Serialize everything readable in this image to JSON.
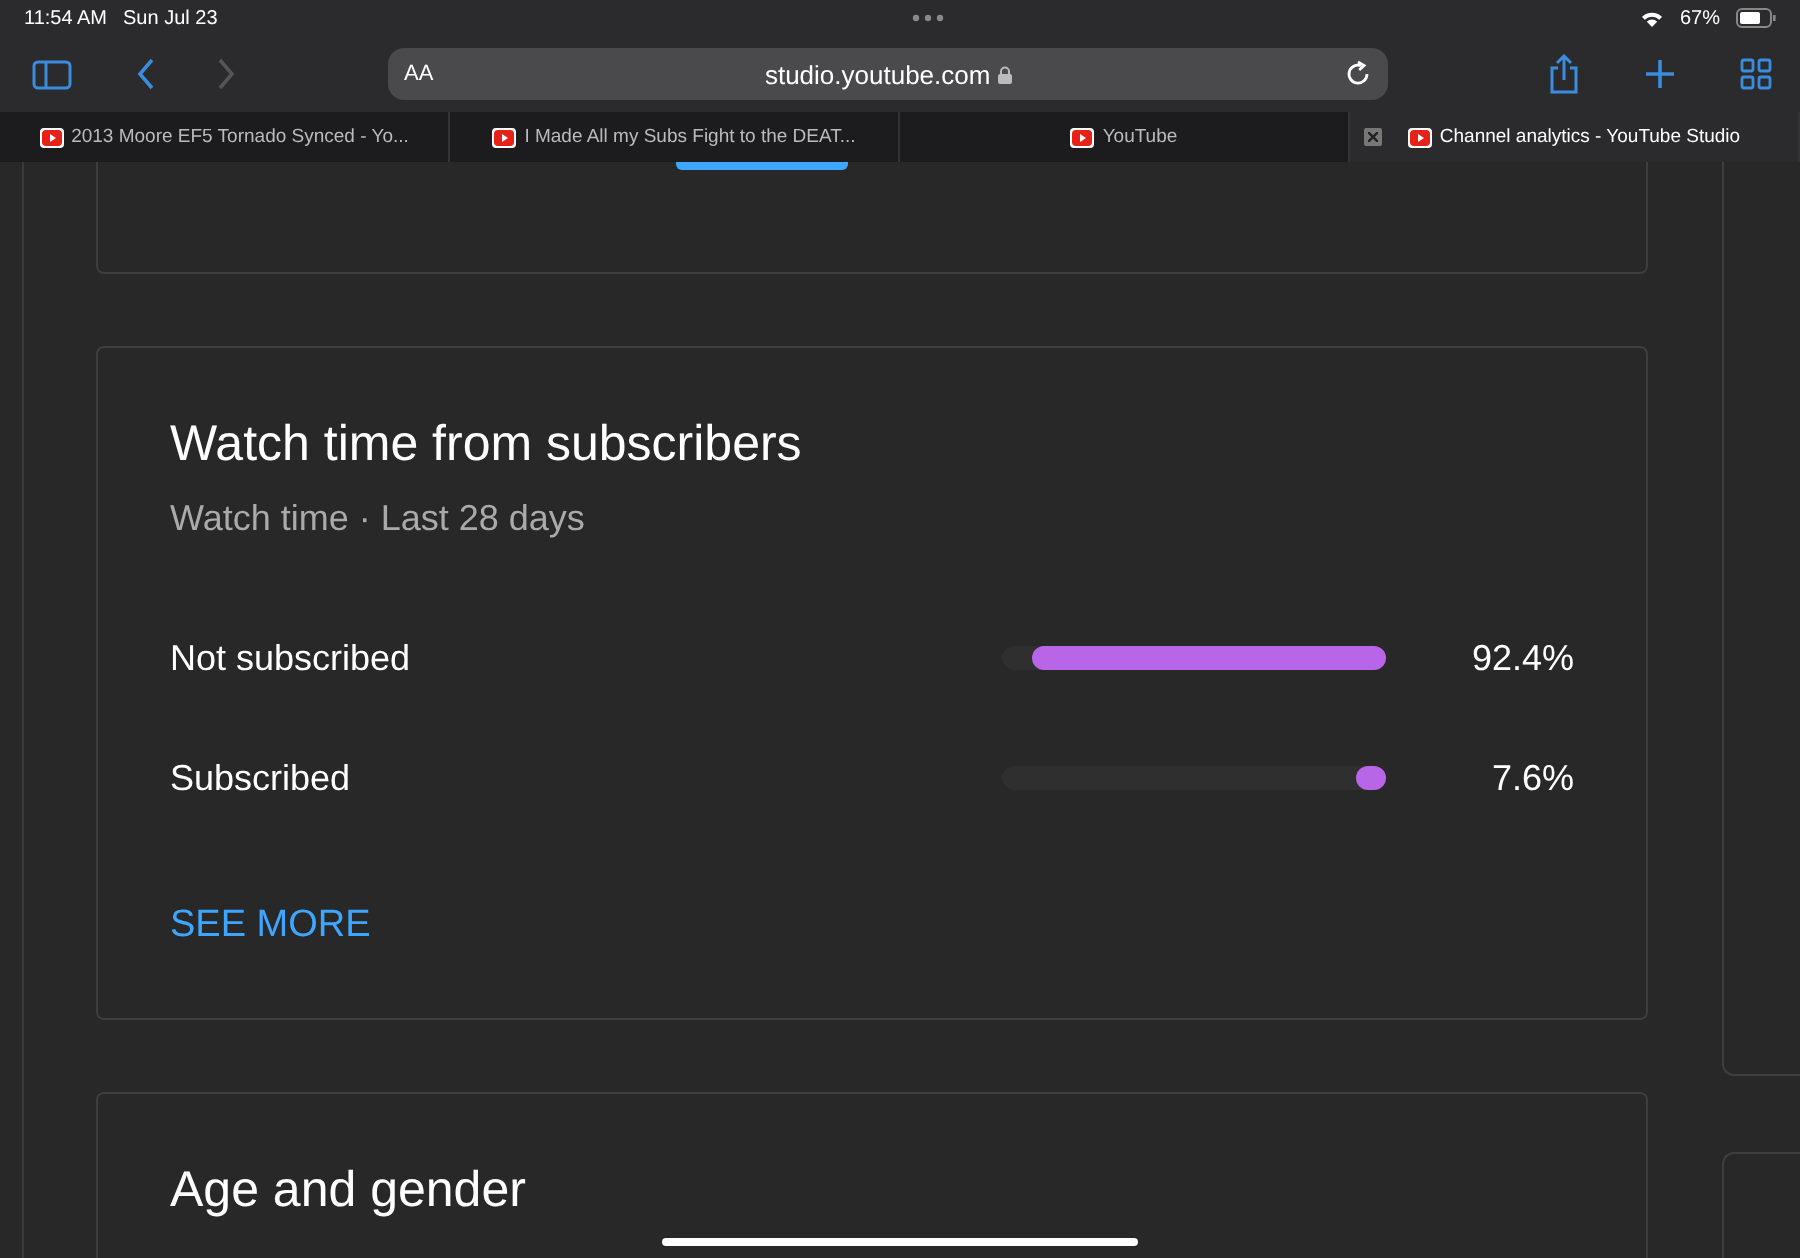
{
  "status_bar": {
    "time": "11:54 AM",
    "date": "Sun Jul 23",
    "battery": "67%"
  },
  "toolbar": {
    "text_size": "AA",
    "address": "studio.youtube.com"
  },
  "tabs": [
    {
      "title": "2013 Moore EF5 Tornado Synced - Yo...",
      "selected": false
    },
    {
      "title": "I Made All my Subs Fight to the DEAT...",
      "selected": false
    },
    {
      "title": "YouTube",
      "selected": false
    },
    {
      "title": "Channel analytics - YouTube Studio",
      "selected": true
    }
  ],
  "card": {
    "title": "Watch time from subscribers",
    "subtitle": "Watch time · Last 28 days",
    "rows": [
      {
        "label": "Not subscribed",
        "level": 0.924,
        "value": "92.4%"
      },
      {
        "label": "Subscribed",
        "level": 0.076,
        "value": "7.6%"
      }
    ],
    "link": "SEE MORE"
  },
  "next_card": {
    "title": "Age and gender"
  }
}
